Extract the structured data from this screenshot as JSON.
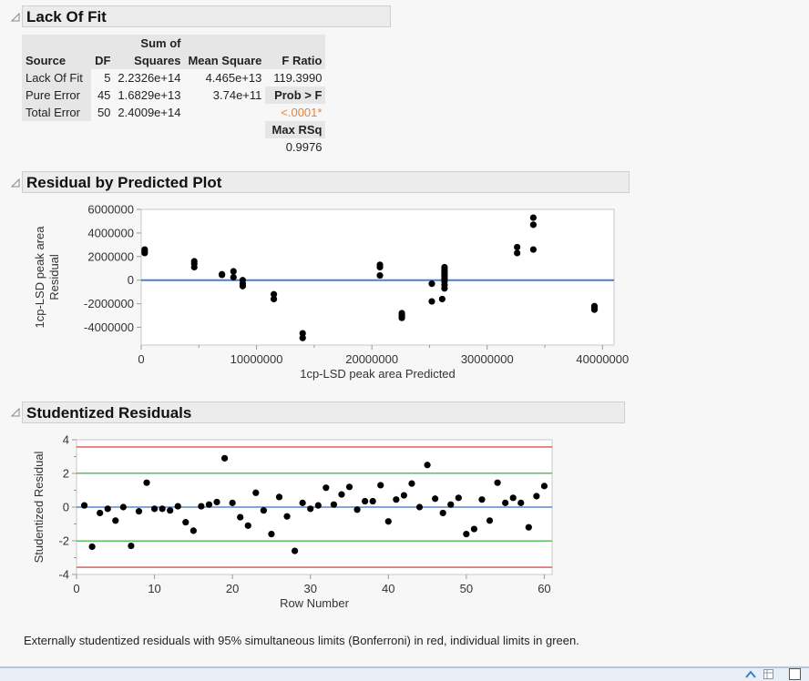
{
  "lack_of_fit": {
    "title": "Lack Of Fit",
    "headers": {
      "source": "Source",
      "df": "DF",
      "ss_top": "Sum of",
      "ss_bottom": "Squares",
      "ms": "Mean Square",
      "fratio": "F Ratio"
    },
    "rows": [
      {
        "source": "Lack Of Fit",
        "df": "5",
        "ss": "2.2326e+14",
        "ms": "4.465e+13",
        "extra": "119.3990"
      },
      {
        "source": "Pure Error",
        "df": "45",
        "ss": "1.6829e+13",
        "ms": "3.74e+11",
        "extra": "Prob > F"
      },
      {
        "source": "Total Error",
        "df": "50",
        "ss": "2.4009e+14",
        "ms": "",
        "extra": "<.0001*"
      }
    ],
    "max_rsq_label": "Max RSq",
    "max_rsq_value": "0.9976",
    "prob_color": "#e8843a"
  },
  "residual_plot": {
    "title": "Residual by Predicted Plot"
  },
  "studentized": {
    "title": "Studentized Residuals",
    "note": "Externally studentized residuals with 95% simultaneous limits (Bonferroni) in red, individual limits in green."
  },
  "chart_data": [
    {
      "type": "scatter",
      "title": "Residual by Predicted Plot",
      "xlabel": "1cp-LSD peak area Predicted",
      "ylabel": "1cp-LSD peak area Residual",
      "xlim": [
        0,
        41000000
      ],
      "ylim": [
        -5500000,
        6000000
      ],
      "xticks": [
        0,
        10000000,
        20000000,
        30000000,
        40000000
      ],
      "xtick_labels": [
        "0",
        "10000000",
        "20000000",
        "30000000",
        "40000000"
      ],
      "yticks": [
        6000000,
        4000000,
        2000000,
        0,
        -2000000,
        -4000000
      ],
      "ytick_labels": [
        "6000000",
        "4000000",
        "2000000",
        "0",
        "-2000000",
        "-4000000"
      ],
      "reference_line": {
        "y": 0,
        "color": "#4a7fc8"
      },
      "points": [
        [
          300000,
          2600000
        ],
        [
          300000,
          2450000
        ],
        [
          300000,
          2300000
        ],
        [
          4600000,
          1600000
        ],
        [
          4600000,
          1400000
        ],
        [
          4600000,
          1100000
        ],
        [
          7000000,
          500000
        ],
        [
          7000000,
          450000
        ],
        [
          8000000,
          750000
        ],
        [
          8000000,
          250000
        ],
        [
          8800000,
          0
        ],
        [
          8800000,
          -300000
        ],
        [
          8800000,
          -500000
        ],
        [
          11500000,
          -1200000
        ],
        [
          11500000,
          -1600000
        ],
        [
          14000000,
          -4500000
        ],
        [
          14000000,
          -4900000
        ],
        [
          20700000,
          1300000
        ],
        [
          20700000,
          1100000
        ],
        [
          20700000,
          400000
        ],
        [
          22600000,
          -2800000
        ],
        [
          22600000,
          -3000000
        ],
        [
          22600000,
          -3200000
        ],
        [
          25200000,
          -300000
        ],
        [
          25200000,
          -1800000
        ],
        [
          26300000,
          1100000
        ],
        [
          26300000,
          900000
        ],
        [
          26300000,
          700000
        ],
        [
          26300000,
          500000
        ],
        [
          26300000,
          300000
        ],
        [
          26300000,
          100000
        ],
        [
          26300000,
          -100000
        ],
        [
          26300000,
          -400000
        ],
        [
          26300000,
          -700000
        ],
        [
          26100000,
          -1600000
        ],
        [
          32600000,
          2800000
        ],
        [
          32600000,
          2300000
        ],
        [
          34000000,
          5300000
        ],
        [
          34000000,
          4700000
        ],
        [
          34000000,
          2600000
        ],
        [
          39300000,
          -2200000
        ],
        [
          39300000,
          -2350000
        ],
        [
          39300000,
          -2500000
        ]
      ]
    },
    {
      "type": "scatter",
      "title": "Studentized Residuals",
      "xlabel": "Row Number",
      "ylabel": "Studentized Residual",
      "xlim": [
        0,
        61
      ],
      "ylim": [
        -4,
        4
      ],
      "xticks": [
        0,
        10,
        20,
        30,
        40,
        50,
        60
      ],
      "xtick_labels": [
        "0",
        "10",
        "20",
        "30",
        "40",
        "50",
        "60"
      ],
      "yticks": [
        4,
        2,
        0,
        -2,
        -4
      ],
      "ytick_labels": [
        "4",
        "2",
        "0",
        "-2",
        "-4"
      ],
      "limits": [
        {
          "name": "Bonferroni simultaneous 95%",
          "values": [
            3.57,
            -3.57
          ],
          "color": "#d9534f"
        },
        {
          "name": "individual",
          "values": [
            2.01,
            -2.01
          ],
          "color": "#4cb84c"
        },
        {
          "name": "zero",
          "values": [
            0
          ],
          "color": "#3a6fc0"
        }
      ],
      "x": [
        1,
        2,
        3,
        4,
        5,
        6,
        7,
        8,
        9,
        10,
        11,
        12,
        13,
        14,
        15,
        16,
        17,
        18,
        19,
        20,
        21,
        22,
        23,
        24,
        25,
        26,
        27,
        28,
        29,
        30,
        31,
        32,
        33,
        34,
        35,
        36,
        37,
        38,
        39,
        40,
        41,
        42,
        43,
        44,
        45,
        46,
        47,
        48,
        49,
        50,
        51,
        52,
        53,
        54,
        55,
        56,
        57,
        58,
        59,
        60
      ],
      "y": [
        0.1,
        -2.35,
        -0.35,
        -0.1,
        -0.8,
        0.0,
        -2.3,
        -0.25,
        1.45,
        -0.1,
        -0.1,
        -0.2,
        0.05,
        -0.9,
        -1.4,
        0.05,
        0.15,
        0.3,
        2.9,
        0.25,
        -0.6,
        -1.1,
        0.85,
        -0.2,
        -1.6,
        0.6,
        -0.55,
        -2.6,
        0.25,
        -0.1,
        0.1,
        1.15,
        0.15,
        0.75,
        1.2,
        -0.15,
        0.35,
        0.35,
        1.3,
        -0.85,
        0.45,
        0.7,
        1.4,
        0.0,
        2.5,
        0.5,
        -0.35,
        0.15,
        0.55,
        -1.6,
        -1.3,
        0.45,
        -0.8,
        1.45,
        0.25,
        0.55,
        0.25,
        -1.2,
        0.65,
        1.25
      ]
    }
  ]
}
